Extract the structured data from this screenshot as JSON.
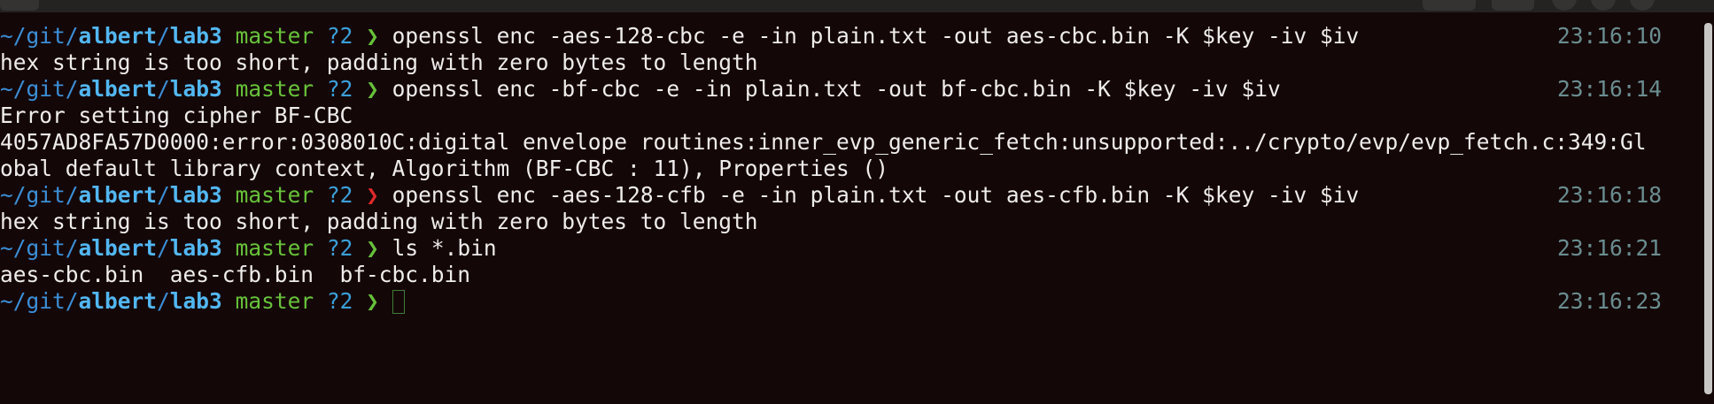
{
  "prompt": {
    "path_prefix": "~/git/",
    "user": "albert",
    "separator": "/",
    "dir": "lab3",
    "branch": "master",
    "status": "?2",
    "chevron": "❯"
  },
  "lines": [
    {
      "type": "prompt",
      "exit": "ok",
      "command": "openssl enc -aes-128-cbc -e -in plain.txt -out aes-cbc.bin -K $key -iv $iv",
      "time": "23:16:10"
    },
    {
      "type": "output",
      "text": "hex string is too short, padding with zero bytes to length"
    },
    {
      "type": "prompt",
      "exit": "ok",
      "command": "openssl enc -bf-cbc -e -in plain.txt -out bf-cbc.bin -K $key -iv $iv",
      "time": "23:16:14"
    },
    {
      "type": "output",
      "text": "Error setting cipher BF-CBC"
    },
    {
      "type": "output",
      "text": "4057AD8FA57D0000:error:0308010C:digital envelope routines:inner_evp_generic_fetch:unsupported:../crypto/evp/evp_fetch.c:349:Gl"
    },
    {
      "type": "output",
      "text": "obal default library context, Algorithm (BF-CBC : 11), Properties ()"
    },
    {
      "type": "prompt",
      "exit": "error",
      "command": "openssl enc -aes-128-cfb -e -in plain.txt -out aes-cfb.bin -K $key -iv $iv",
      "time": "23:16:18"
    },
    {
      "type": "output",
      "text": "hex string is too short, padding with zero bytes to length"
    },
    {
      "type": "prompt",
      "exit": "ok",
      "command": "ls *.bin",
      "time": "23:16:21"
    },
    {
      "type": "output",
      "text": "aes-cbc.bin  aes-cfb.bin  bf-cbc.bin"
    },
    {
      "type": "prompt",
      "exit": "ok",
      "command": "",
      "time": "23:16:23",
      "cursor": true
    }
  ],
  "colors": {
    "background": "#140707",
    "path": "#3b8fd6",
    "user_dir": "#52b7f2",
    "branch": "#67c23a",
    "chevron_ok": "#67c23a",
    "chevron_error": "#e02a2a",
    "timestamp": "#6a8d90",
    "text": "#efecec"
  },
  "icons": {
    "cursor": "block-cursor-outline"
  }
}
